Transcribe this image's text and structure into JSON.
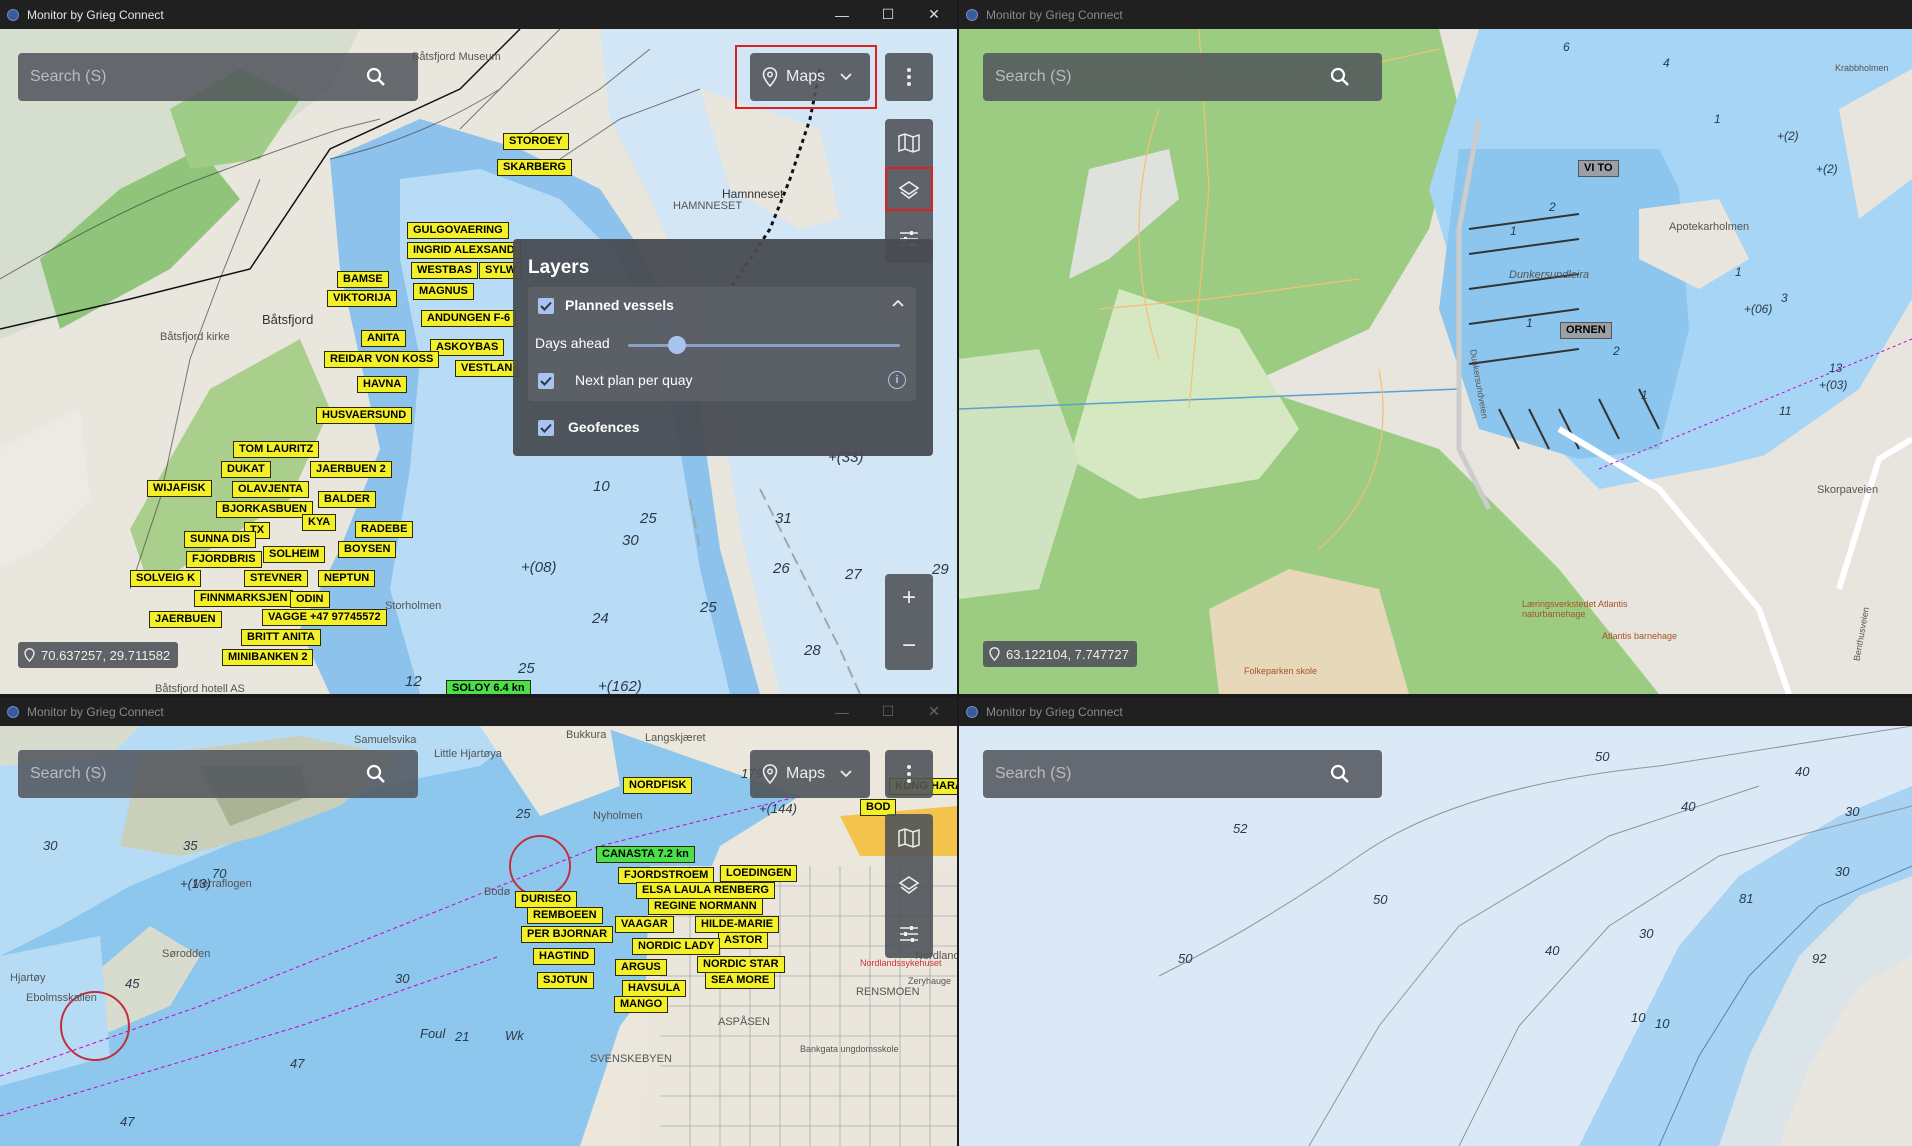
{
  "app_title": "Monitor by Grieg Connect",
  "window_controls": {
    "minimize": "—",
    "maximize": "☐",
    "close": "✕"
  },
  "search_placeholder": "Search (S)",
  "maps_label": "Maps",
  "layers": {
    "title": "Layers",
    "planned_vessels": "Planned vessels",
    "days_ahead": "Days ahead",
    "days_ahead_level": 0.18,
    "next_plan_per_quay": "Next plan per quay",
    "geofences": "Geofences"
  },
  "window1": {
    "coords": "70.637257, 29.711582",
    "vessels": [
      "STOROEY",
      "SKARBERG",
      "GULGOVAERING",
      "INGRID ALEXSAND",
      "WESTBAS",
      "SYLW",
      "BAMSE",
      "MAGNUS",
      "VIKTORIJA",
      "ANDUNGEN F-6",
      "ANITA",
      "ASKOYBAS",
      "REIDAR VON KOSS",
      "VESTLAN",
      "HAVNA",
      "HUSVAERSUND",
      "TOM LAURITZ",
      "DUKAT",
      "JAERBUEN 2",
      "WIJAFISK",
      "OLAVJENTA",
      "BJORKASBUEN",
      "BALDER",
      "KYA",
      "TX",
      "SUNNA DIS",
      "RADEBE",
      "FJORDBRIS",
      "SOLHEIM",
      "BOYSEN",
      "SOLVEIG K",
      "STEVNER",
      "NEPTUN",
      "FINNMARKSJEN",
      "ODIN",
      "JAERBUEN",
      "VAGGE +47 97745572",
      "BRITT ANITA",
      "MINIBANKEN 2"
    ],
    "moving_vessel": "SOLOY 6.4 kn",
    "places": [
      "Båtsfjord Museum",
      "Båtsfjord",
      "Båtsfjord kirke",
      "HAMNNESET",
      "Hamnneset",
      "Båtsfjord hotell AS",
      "Storholmen"
    ],
    "depths": [
      "10",
      "25",
      "30",
      "31",
      "26",
      "27",
      "29",
      "25",
      "24",
      "28",
      "25",
      "12",
      "+(162)",
      "+(08)",
      "+(33)"
    ]
  },
  "window2": {
    "coords": "63.122104, 7.747727",
    "places": [
      "VI TO",
      "ORNEN",
      "Dunkersundleira",
      "Apotekarholmen",
      "Krabbholmen",
      "Skorpaveien",
      "Læringsverkstedet Atlantis naturbarnehage",
      "Atlantis barnehage",
      "Folkeparken skole",
      "Benthusveien",
      "Dunkersundveien"
    ],
    "depths": [
      "6",
      "4",
      "2",
      "1",
      "1",
      "2",
      "1",
      "1",
      "1",
      "3",
      "+(06)",
      "+(2)",
      "+(03)",
      "13",
      "11",
      "+(2)"
    ]
  },
  "window3": {
    "vessels": [
      "NORDFISK",
      "KONG HARA",
      "BOD",
      "FJORDSTROEM",
      "LOEDINGEN",
      "ELSA LAULA RENBERG",
      "DURISEO",
      "REGINE NORMANN",
      "REMBOEEN",
      "VAAGAR",
      "HILDE-MARIE",
      "PER BJORNAR",
      "ASTOR",
      "NORDIC LADY",
      "HAGTIND",
      "ARGUS",
      "NORDIC STAR",
      "SJOTUN",
      "SEA MORE",
      "HAVSULA",
      "MANGO"
    ],
    "moving_vessel": "CANASTA 7.2 kn",
    "places": [
      "Samuelsvika",
      "Little Hjartøya",
      "Langskjæret",
      "Bukkura",
      "Nyholmen",
      "Merraflogen",
      "Sørodden",
      "Ebolmsskallen",
      "Hjartøy",
      "Bodø",
      "ASPÅSEN",
      "SVENSKEBYEN",
      "Bankgata ungdomsskole",
      "Nordlandssykehuset",
      "Zeryhauge",
      "RENSMOEN",
      "Nordland",
      "Foul",
      "Wk"
    ],
    "depths": [
      "30",
      "70",
      "35",
      "45",
      "47",
      "30",
      "21",
      "25",
      "47",
      "179",
      "+(144)",
      "+(13)"
    ]
  },
  "window4": {
    "depths": [
      "50",
      "52",
      "40",
      "40",
      "30",
      "50",
      "50",
      "40",
      "30",
      "81",
      "92",
      "30",
      "10",
      "10"
    ]
  }
}
